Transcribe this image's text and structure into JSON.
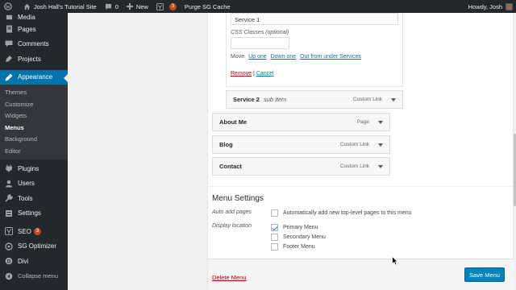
{
  "adminbar": {
    "site_name": "Josh Hall's Tutorial Site",
    "comments_count": "0",
    "new_label": "New",
    "updates_count": "3",
    "purge_label": "Purge SG Cache",
    "howdy": "Howdy, Josh"
  },
  "sidebar": {
    "items_top": [
      {
        "label": "Media",
        "icon": "media-icon"
      },
      {
        "label": "Pages",
        "icon": "pages-icon"
      },
      {
        "label": "Comments",
        "icon": "comments-icon"
      },
      {
        "label": "Projects",
        "icon": "projects-icon"
      }
    ],
    "active": {
      "label": "Appearance",
      "icon": "appearance-icon"
    },
    "sub_items": [
      "Themes",
      "Customize",
      "Widgets",
      "Menus",
      "Background",
      "Editor"
    ],
    "items_bottom": [
      {
        "label": "Plugins",
        "icon": "plugins-icon"
      },
      {
        "label": "Users",
        "icon": "users-icon"
      },
      {
        "label": "Tools",
        "icon": "tools-icon"
      },
      {
        "label": "Settings",
        "icon": "settings-icon"
      }
    ],
    "seo_label": "SEO",
    "seo_count": "3",
    "sg_label": "SG Optimizer",
    "divi_label": "Divi",
    "collapse_label": "Collapse menu"
  },
  "item_settings": {
    "nav_label_value": "Service 1",
    "css_classes_label": "CSS Classes (optional)",
    "css_classes_value": "",
    "move_label": "Move",
    "move_up": "Up one",
    "move_down": "Down one",
    "move_out": "Out from under Services",
    "remove": "Remove",
    "separator": "|",
    "cancel": "Cancel"
  },
  "menu_items": [
    {
      "title": "Service 2",
      "sub": "sub item",
      "type": "Custom Link"
    },
    {
      "title": "About Me",
      "sub": "",
      "type": "Page"
    },
    {
      "title": "Blog",
      "sub": "",
      "type": "Custom Link"
    },
    {
      "title": "Contact",
      "sub": "",
      "type": "Custom Link"
    }
  ],
  "menu_settings": {
    "heading": "Menu Settings",
    "auto_add_label": "Auto add pages",
    "auto_add_text": "Automatically add new top-level pages to this menu",
    "display_location_label": "Display location",
    "locations": [
      {
        "label": "Primary Menu",
        "checked": true
      },
      {
        "label": "Secondary Menu",
        "checked": false
      },
      {
        "label": "Footer Menu",
        "checked": false
      }
    ]
  },
  "footer": {
    "delete": "Delete Menu",
    "save": "Save Menu"
  },
  "colors": {
    "accent": "#0073aa",
    "admin_dark": "#23282d",
    "danger": "#a00"
  }
}
